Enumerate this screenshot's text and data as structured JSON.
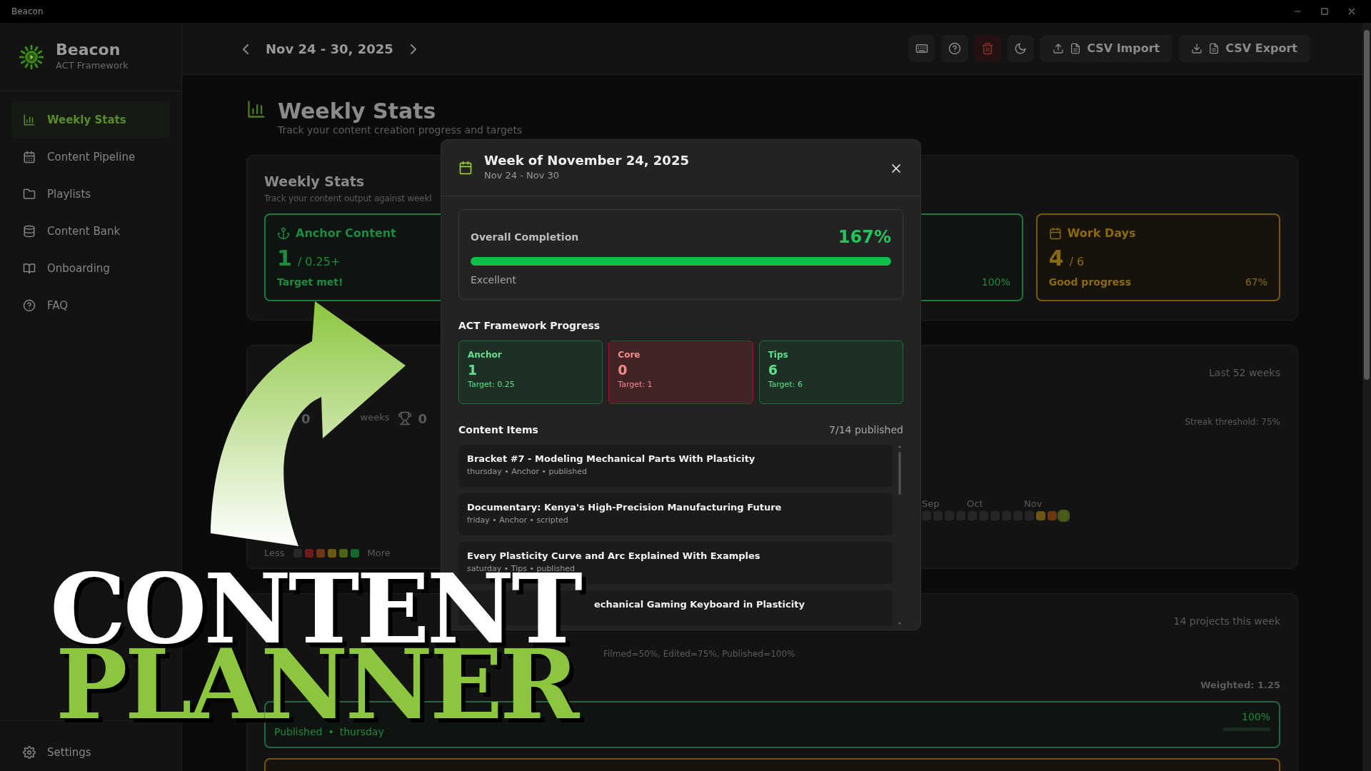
{
  "window": {
    "title": "Beacon"
  },
  "sidebar": {
    "brand": "Beacon",
    "tagline": "ACT Framework",
    "items": [
      {
        "label": "Weekly Stats",
        "selected": true
      },
      {
        "label": "Content Pipeline",
        "selected": false
      },
      {
        "label": "Playlists",
        "selected": false
      },
      {
        "label": "Content Bank",
        "selected": false
      },
      {
        "label": "Onboarding",
        "selected": false
      },
      {
        "label": "FAQ",
        "selected": false
      }
    ],
    "footer": {
      "label": "Settings"
    }
  },
  "topbar": {
    "date_range": "Nov 24 - 30, 2025",
    "actions": [
      {
        "kind": "icon",
        "danger": false
      },
      {
        "kind": "icon",
        "danger": false
      },
      {
        "kind": "icon",
        "danger": true
      },
      {
        "kind": "icon",
        "danger": false
      },
      {
        "kind": "text",
        "danger": false,
        "label": "CSV Import"
      },
      {
        "kind": "text",
        "danger": false,
        "label": "CSV Export"
      }
    ]
  },
  "page_header": {
    "title": "Weekly Stats",
    "subtitle": "Track your content creation progress and targets"
  },
  "weekly_card": {
    "title": "Weekly Stats",
    "subtitle": "Track your content output against weekl",
    "stats": [
      {
        "kind": "full",
        "color": "#1b7a38",
        "label": "Anchor Content",
        "value": "1",
        "target": "/ 0.25+",
        "note": "Target met!"
      },
      {
        "kind": "partial",
        "color": "#1b7a38",
        "percent": "100%"
      },
      {
        "kind": "full",
        "color": "#7a5a08",
        "label": "Work Days",
        "value": "4",
        "target": "/ 6",
        "note": "Good progress",
        "percent": "67%"
      }
    ]
  },
  "streak_card": {
    "range": "Last 52 weeks",
    "current": {
      "value": "0",
      "unit": "weeks"
    },
    "longest": {
      "value": "0"
    },
    "threshold": "Streak threshold: 75%",
    "months": [
      "Sep",
      "Oct",
      "Nov"
    ],
    "cells": [
      {
        "color": "#262626",
        "selected": false
      },
      {
        "color": "#262626",
        "selected": false
      },
      {
        "color": "#262626",
        "selected": false
      },
      {
        "color": "#262626",
        "selected": false
      },
      {
        "color": "#262626",
        "selected": false
      },
      {
        "color": "#262626",
        "selected": false
      },
      {
        "color": "#262626",
        "selected": false
      },
      {
        "color": "#262626",
        "selected": false
      },
      {
        "color": "#262626",
        "selected": false
      },
      {
        "color": "#262626",
        "selected": false
      },
      {
        "color": "#6e5510",
        "selected": false
      },
      {
        "color": "#6e3512",
        "selected": false
      },
      {
        "color": "#4d5a1c",
        "selected": true
      }
    ],
    "legend": {
      "less": "Less",
      "more": "More",
      "swatches": [
        {
          "color": "#282828"
        },
        {
          "color": "#6e1a1a"
        },
        {
          "color": "#6e3512"
        },
        {
          "color": "#6e5510"
        },
        {
          "color": "#4a6512"
        },
        {
          "color": "#146a2e"
        }
      ]
    }
  },
  "projects_card": {
    "count": "14 projects this week",
    "formula": "Filmed=50%, Edited=75%, Published=100%",
    "weighted": "Weighted: 1.25",
    "rows": [
      {
        "color": "#1b6a44",
        "status": "Published",
        "separator": "•",
        "day": "thursday",
        "percent": "100%",
        "level": 1
      },
      {
        "color": "#7a5208"
      }
    ]
  },
  "modal": {
    "title": "Week of November 24, 2025",
    "subtitle": "Nov 24 - Nov 30",
    "completion": {
      "label": "Overall Completion",
      "value": "167%",
      "level": 1,
      "rating": "Excellent"
    },
    "framework": {
      "title": "ACT Framework Progress",
      "items": [
        {
          "label": "Anchor",
          "value": "1",
          "target": "Target: 0.25",
          "met": true
        },
        {
          "label": "Core",
          "value": "0",
          "target": "Target: 1",
          "met": false
        },
        {
          "label": "Tips",
          "value": "6",
          "target": "Target: 6",
          "met": true
        }
      ]
    },
    "items_title": "Content Items",
    "items_count": "7/14 published",
    "items": [
      {
        "title": "Bracket #7 - Modeling Mechanical Parts With Plasticity",
        "meta": "thursday • Anchor • published"
      },
      {
        "title": "Documentary: Kenya's High-Precision Manufacturing Future",
        "meta": "friday • Anchor • scripted"
      },
      {
        "title": "Every Plasticity Curve and Arc Explained With Examples",
        "meta": "saturday • Tips • published"
      },
      {
        "title": "echanical Gaming Keyboard in Plasticity"
      }
    ]
  },
  "overlay": {
    "headline": [
      {
        "text": "CONTENT",
        "color": "#ffffff"
      },
      {
        "text": "PLANNER",
        "color": "#8cc63f"
      }
    ]
  }
}
